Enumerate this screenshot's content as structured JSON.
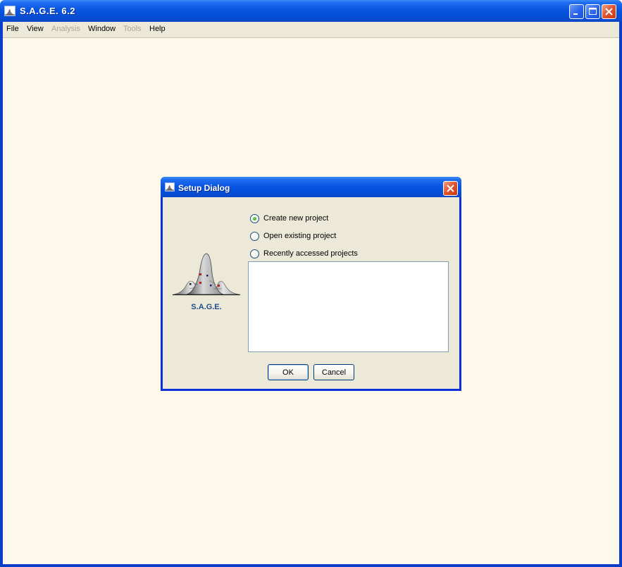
{
  "window": {
    "title": "S.A.G.E. 6.2"
  },
  "menubar": {
    "items": [
      {
        "label": "File",
        "enabled": true
      },
      {
        "label": "View",
        "enabled": true
      },
      {
        "label": "Analysis",
        "enabled": false
      },
      {
        "label": "Window",
        "enabled": true
      },
      {
        "label": "Tools",
        "enabled": false
      },
      {
        "label": "Help",
        "enabled": true
      }
    ]
  },
  "dialog": {
    "title": "Setup Dialog",
    "logo_label": "S.A.G.E.",
    "options": [
      {
        "label": "Create new project",
        "selected": true
      },
      {
        "label": "Open existing project",
        "selected": false
      },
      {
        "label": "Recently accessed projects",
        "selected": false
      }
    ],
    "recent_projects": [],
    "ok_label": "OK",
    "cancel_label": "Cancel"
  },
  "colors": {
    "titlebar": "#0a55e0",
    "client_bg": "#fdf8ec",
    "dialog_bg": "#ece9d8",
    "close_button": "#e0522c"
  }
}
